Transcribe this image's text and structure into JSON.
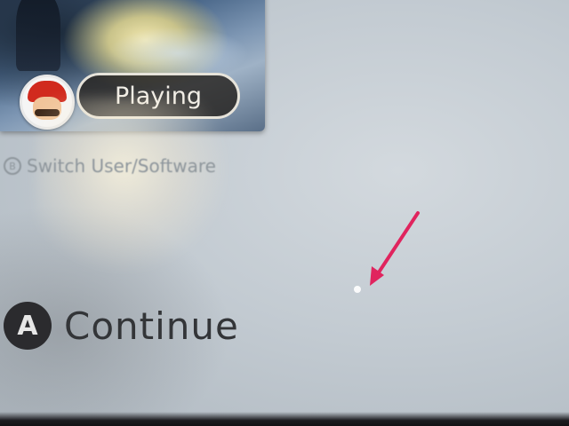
{
  "game_card": {
    "status_label": "Playing",
    "avatar_icon": "mario-avatar-icon"
  },
  "hints": {
    "switch_user": {
      "button_icon": "b-button-icon",
      "label": "Switch User/Software"
    },
    "continue": {
      "button_letter": "A",
      "label": "Continue"
    }
  },
  "annotation": {
    "arrow_color": "#e0245e"
  }
}
